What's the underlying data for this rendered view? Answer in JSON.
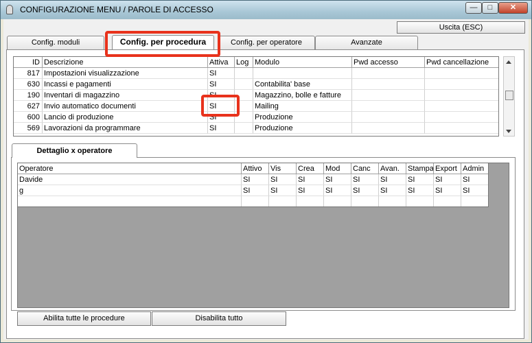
{
  "window": {
    "title": "CONFIGURAZIONE MENU / PAROLE DI ACCESSO",
    "controls": {
      "minimize": "—",
      "maximize": "□",
      "close": "✕"
    }
  },
  "toolbar": {
    "exit_label": "Uscita (ESC)"
  },
  "tabs": [
    {
      "label": "Config. moduli"
    },
    {
      "label": "Config. per procedura"
    },
    {
      "label": "Config. per operatore"
    },
    {
      "label": "Avanzate"
    }
  ],
  "procedures": {
    "columns": [
      "ID",
      "Descrizione",
      "Attiva",
      "Log",
      "Modulo",
      "Pwd accesso",
      "Pwd cancellazione"
    ],
    "rows": [
      {
        "id": "817",
        "desc": "Impostazioni visualizzazione",
        "attiva": "SI",
        "log": "",
        "modulo": "",
        "pwd_acc": "",
        "pwd_canc": ""
      },
      {
        "id": "630",
        "desc": "Incassi e pagamenti",
        "attiva": "SI",
        "log": "",
        "modulo": "Contabilita' base",
        "pwd_acc": "",
        "pwd_canc": ""
      },
      {
        "id": "190",
        "desc": "Inventari di magazzino",
        "attiva": "SI",
        "log": "",
        "modulo": "Magazzino, bolle e fatture",
        "pwd_acc": "",
        "pwd_canc": ""
      },
      {
        "id": "627",
        "desc": "Invio automatico documenti",
        "attiva": "SI",
        "log": "",
        "modulo": "Mailing",
        "pwd_acc": "",
        "pwd_canc": ""
      },
      {
        "id": "600",
        "desc": "Lancio di produzione",
        "attiva": "SI",
        "log": "",
        "modulo": "Produzione",
        "pwd_acc": "",
        "pwd_canc": ""
      },
      {
        "id": "569",
        "desc": "Lavorazioni da programmare",
        "attiva": "SI",
        "log": "",
        "modulo": "Produzione",
        "pwd_acc": "",
        "pwd_canc": ""
      }
    ]
  },
  "detail": {
    "tab_label": "Dettaglio x operatore",
    "columns": [
      "Operatore",
      "Attivo",
      "Vis",
      "Crea",
      "Mod",
      "Canc",
      "Avan.",
      "Stampa",
      "Export",
      "Admin"
    ],
    "rows": [
      {
        "values": [
          "Davide",
          "SI",
          "SI",
          "SI",
          "SI",
          "SI",
          "SI",
          "SI",
          "SI",
          "SI"
        ]
      },
      {
        "values": [
          "g",
          "SI",
          "SI",
          "SI",
          "SI",
          "SI",
          "SI",
          "SI",
          "SI",
          "SI"
        ]
      }
    ]
  },
  "actions": {
    "enable_all": "Abilita tutte le procedure",
    "disable_all": "Disabilita tutto"
  },
  "colors": {
    "highlight": "#e8321c",
    "panel_gray": "#a0a0a0",
    "title_bar": "#a9c7d6"
  }
}
